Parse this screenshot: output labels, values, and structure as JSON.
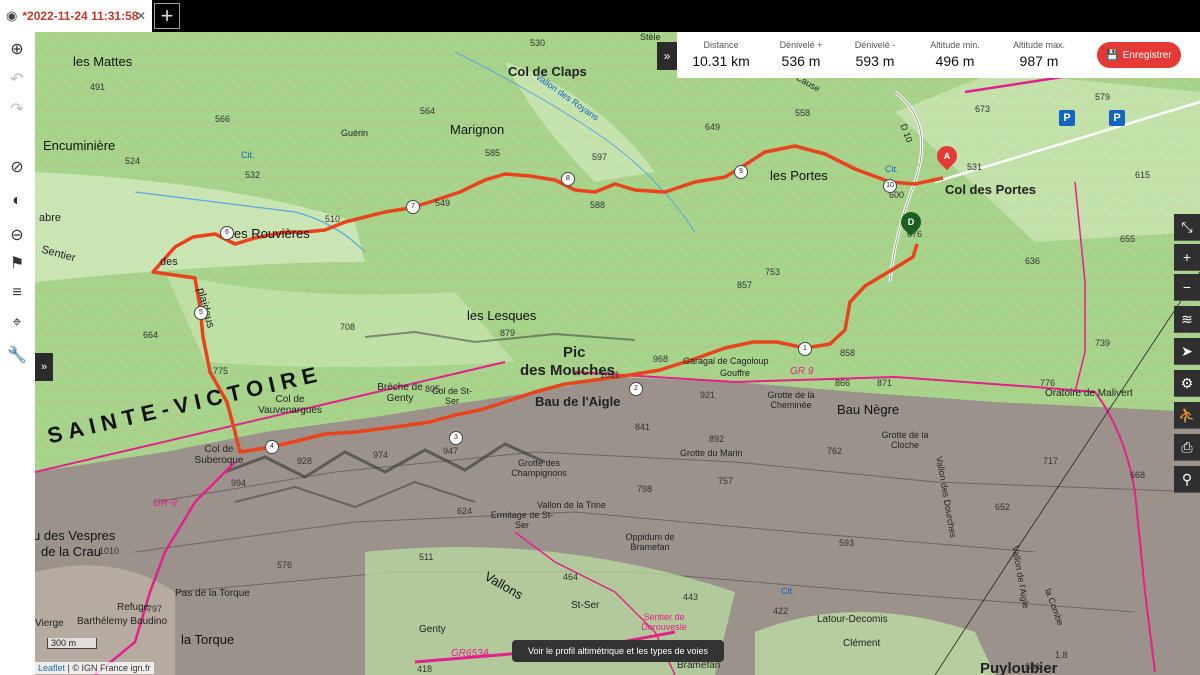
{
  "tab": {
    "title": "*2022-11-24 11:31:58",
    "close": "✕",
    "new": "+"
  },
  "stats": [
    {
      "label": "Distance",
      "value": "10.31 km"
    },
    {
      "label": "Dénivelé +",
      "value": "536 m"
    },
    {
      "label": "Dénivelé -",
      "value": "593 m"
    },
    {
      "label": "Altitude min.",
      "value": "496 m"
    },
    {
      "label": "Altitude max.",
      "value": "987 m"
    }
  ],
  "save_label": "Enregistrer",
  "collapse_label": "»",
  "left_tools": [
    "eye-icon",
    "zoom-icon",
    "undo-icon",
    "redo-icon",
    "no-entry-icon",
    "toggle-icon",
    "hide-icon",
    "route-icon",
    "menu-icon",
    "add-poi-icon",
    "wrench-icon"
  ],
  "right_tools": [
    "⤡",
    "+",
    "−",
    "≋",
    "➤",
    "⚙",
    "⛹",
    "⎙",
    "⚲"
  ],
  "map": {
    "labels": {
      "les_mattes": "les Mattes",
      "encuminiere": "Encuminière",
      "marignon": "Marignon",
      "col_de_claps": "Col de Claps",
      "les_portes": "les Portes",
      "col_des_portes": "Col des Portes",
      "les_rouvieres": "les Rouvières",
      "sentier": "Sentier",
      "des": "des",
      "plaideus": "plaideus",
      "les_lesques": "les Lesques",
      "pic": "Pic",
      "des_mouches": "des Mouches",
      "sainte_victoire": "SAINTE-VICTOIRE",
      "breche_de_genty": "Brèche de Genty",
      "col_de_vauvenargues": "Col de Vauvenargues",
      "col_de_subercque": "Col de Suberoque",
      "bau_de_laigle": "Bau de l'Aigle",
      "col_de_st_ser": "Col de St-Ser",
      "garagai": "Garagai de Cagoloup",
      "gouffre": "Gouffre",
      "grotte_cheminee": "Grotte de la Cheminée",
      "bau_negre": "Bau Nègre",
      "oratoire": "Oratoire de Malivert",
      "grotte_marin": "Grotte du Marin",
      "grotte_champignons": "Grotte des Champignons",
      "grotte_cloche": "Grotte de la Cloche",
      "vallon_latrine": "Vallon de la Trine",
      "ermitage": "Ermitage de St-Ser",
      "oppidum": "Oppidum de Bramefan",
      "vespres": "u des Vespres",
      "de_la_crau": "de la Crau",
      "pas_torque": "Pas de la Torque",
      "refuge": "Refuge",
      "barthelemy": "Barthélemy Baudino",
      "la_torque": "la Torque",
      "vierge": "Vierge",
      "genty": "Genty",
      "st_ser": "St-Ser",
      "vallons": "Vallons",
      "latour": "Latour-Decomis",
      "clement": "Clément",
      "puyloubier": "Puyloubier",
      "bramefan": "Bramefan",
      "sentier_derouvesle": "Sentier de Derouvesle",
      "gr9": "GR 9",
      "gr9b": "GR-9",
      "gr653a": "GR653A",
      "guerin": "Guérin",
      "cabre": "abre",
      "cit": "Cit.",
      "cit2": "Cit.",
      "cit3": "Cit.",
      "d10": "D 10",
      "cause": "Cause",
      "vallon_des_royans": "Vallon des Royans",
      "vallon_aigle": "Vallon de l'Aigle",
      "vallon_dourches": "Vallon des Dourches",
      "sstele": "Stèle",
      "combe": "la Combe"
    },
    "heights": [
      "530",
      "491",
      "566",
      "564",
      "524",
      "532",
      "585",
      "597",
      "649",
      "558",
      "588",
      "549",
      "510",
      "673",
      "579",
      "615",
      "655",
      "636",
      "753",
      "857",
      "708",
      "879",
      "664",
      "775",
      "805",
      "968",
      "858",
      "1011",
      "921",
      "866",
      "871",
      "776",
      "739",
      "668",
      "892",
      "762",
      "717",
      "757",
      "798",
      "624",
      "841",
      "947",
      "974",
      "928",
      "994",
      "1010",
      "511",
      "576",
      "464",
      "443",
      "422",
      "418",
      "797",
      "531",
      "600",
      "676",
      "1.8",
      "583",
      "593",
      "652"
    ],
    "waypoints": [
      "1",
      "2",
      "3",
      "4",
      "5",
      "6",
      "7",
      "8",
      "9",
      "10"
    ],
    "start_marker": "A",
    "end_marker": "D",
    "scale": "300 m",
    "attribution_leaflet": "Leaflet",
    "attribution_ign": "© IGN France ign.fr",
    "profile_tip": "Voir le profil altimétrique et les types de voies",
    "parking": "P",
    "colors": {
      "route": "#e8431d",
      "gr": "#e4208c",
      "forest": "#a8d58a",
      "rock": "#8f8780"
    }
  }
}
